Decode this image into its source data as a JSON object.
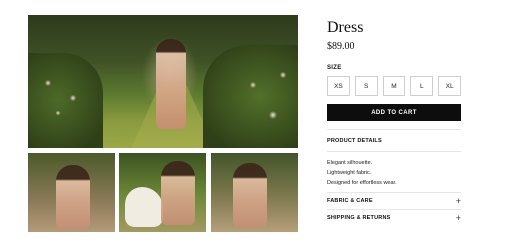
{
  "product": {
    "title": "Dress",
    "price": "$89.00"
  },
  "size_selector": {
    "label": "SIZE",
    "options": [
      "XS",
      "S",
      "M",
      "L",
      "XL"
    ]
  },
  "cart": {
    "button_label": "ADD TO CART"
  },
  "details": {
    "heading": "PRODUCT DETAILS",
    "lines": [
      "Elegant silhouette.",
      "Lightweight fabric.",
      "Designed for effortless wear."
    ]
  },
  "accordions": [
    {
      "label": "FABRIC & CARE",
      "icon": "plus"
    },
    {
      "label": "SHIPPING & RETURNS",
      "icon": "plus"
    }
  ],
  "colors": {
    "cart_button": "#0d0d0d",
    "border": "#cfcfcf"
  }
}
